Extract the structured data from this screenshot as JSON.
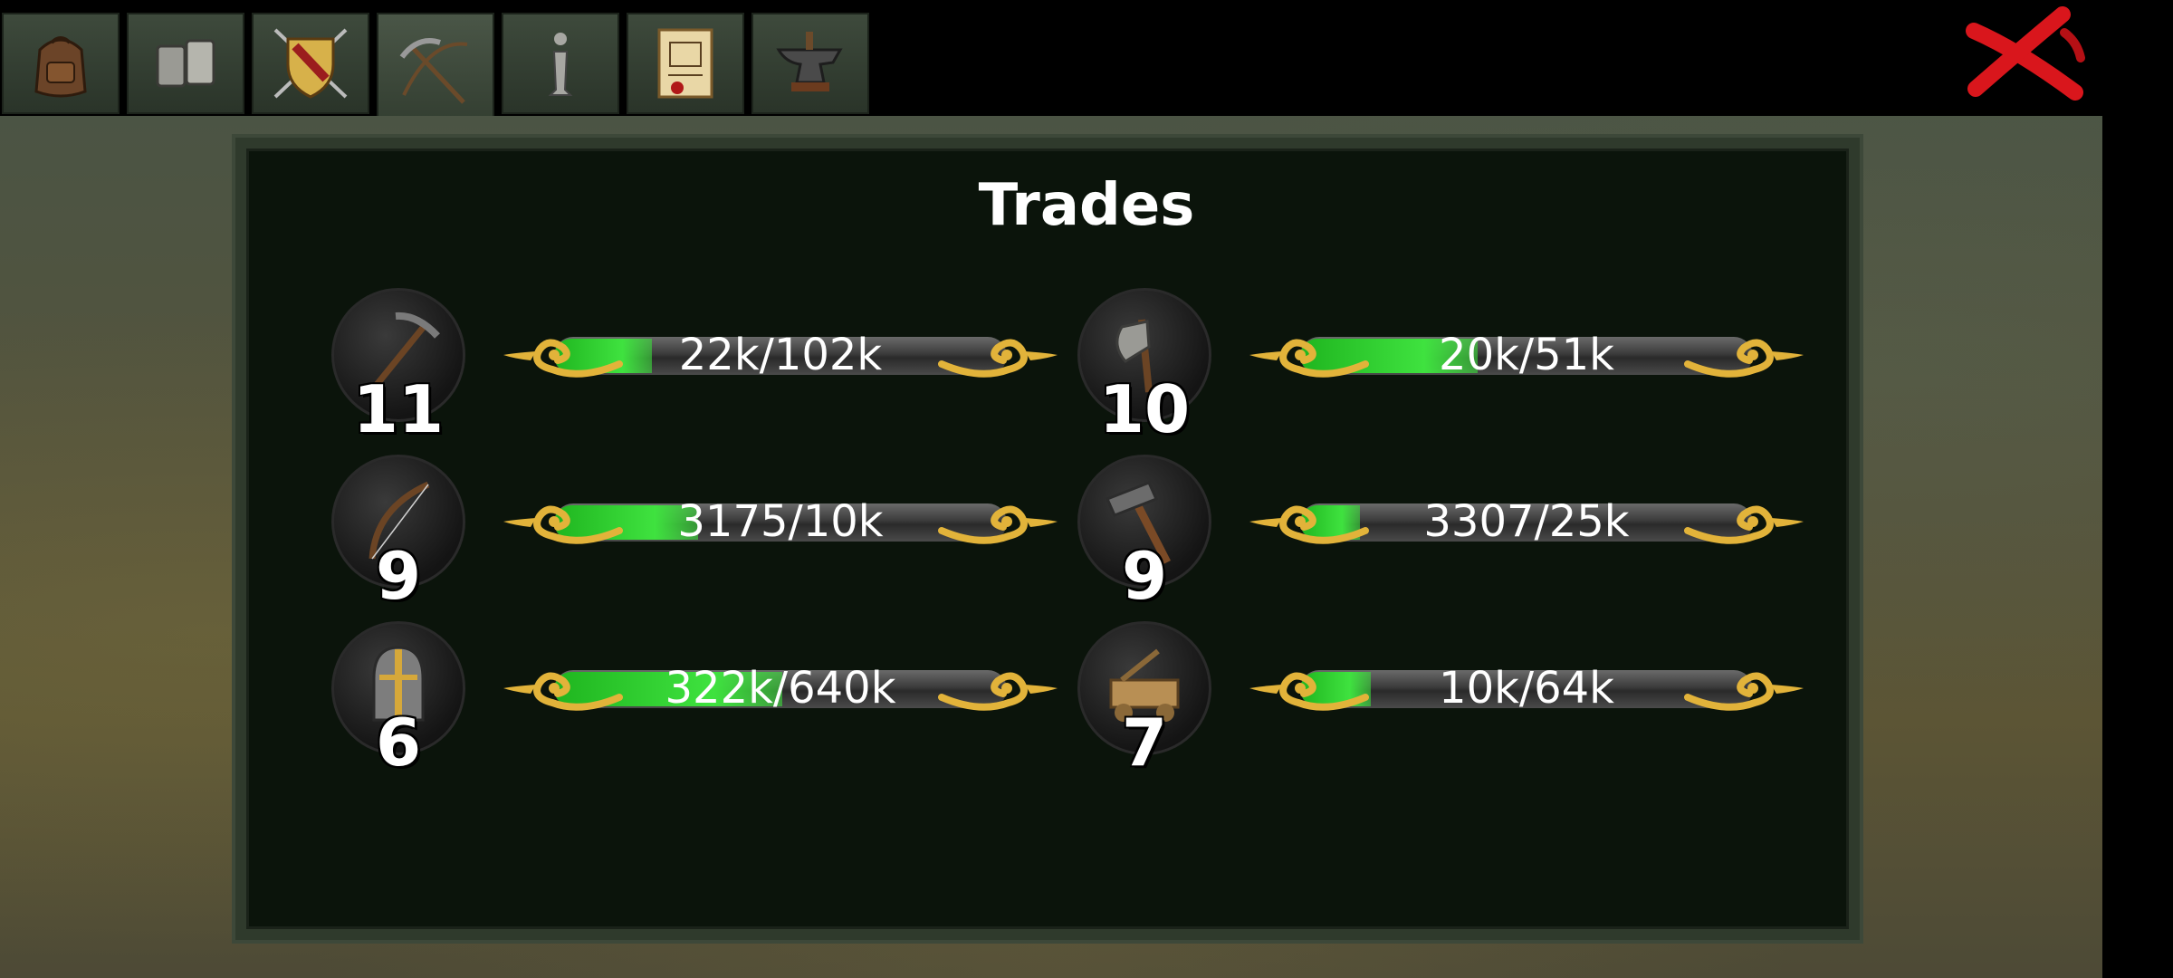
{
  "tabs": [
    {
      "name": "inventory",
      "icon": "backpack-icon"
    },
    {
      "name": "tavern",
      "icon": "mug-icon"
    },
    {
      "name": "heraldry",
      "icon": "shield-swords-icon"
    },
    {
      "name": "trades",
      "icon": "pickaxe-bow-icon",
      "active": true
    },
    {
      "name": "info",
      "icon": "info-icon"
    },
    {
      "name": "quests",
      "icon": "scroll-icon"
    },
    {
      "name": "smithing",
      "icon": "anvil-icon"
    }
  ],
  "close_icon": "close-x-icon",
  "panel": {
    "title": "Trades"
  },
  "trades": [
    {
      "icon": "pickaxe-icon",
      "level": "11",
      "progress_text": "22k/102k",
      "progress": 0.216
    },
    {
      "icon": "axe-icon",
      "level": "10",
      "progress_text": "20k/51k",
      "progress": 0.392
    },
    {
      "icon": "bow-icon",
      "level": "9",
      "progress_text": "3175/10k",
      "progress": 0.3175
    },
    {
      "icon": "hammer-icon",
      "level": "9",
      "progress_text": "3307/25k",
      "progress": 0.132
    },
    {
      "icon": "helmet-icon",
      "level": "6",
      "progress_text": "322k/640k",
      "progress": 0.503
    },
    {
      "icon": "siege-engine-icon",
      "level": "7",
      "progress_text": "10k/64k",
      "progress": 0.156
    }
  ],
  "colors": {
    "progress_fill": "#2fd22f",
    "ornament": "#e2b33a",
    "close": "#d9161c",
    "board": "#0b140b"
  }
}
